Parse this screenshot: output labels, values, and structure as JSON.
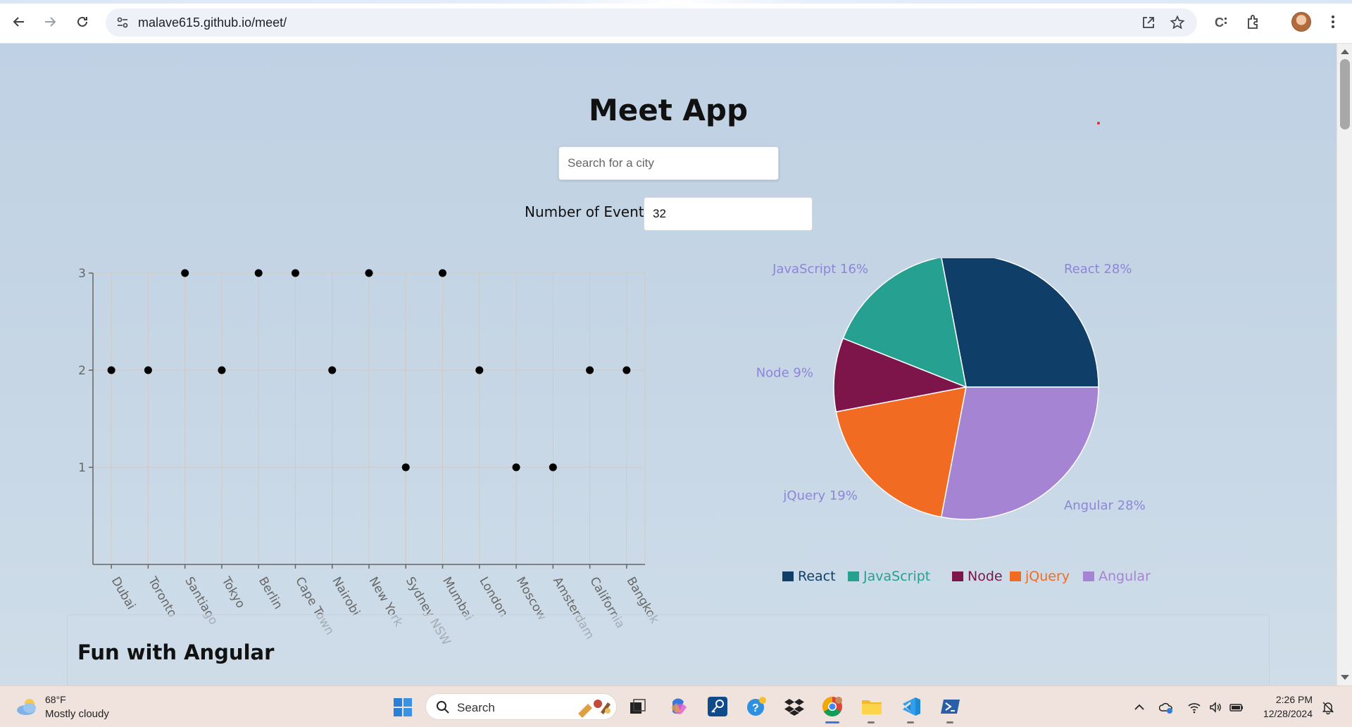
{
  "browser": {
    "url": "malave615.github.io/meet/"
  },
  "app": {
    "title": "Meet App",
    "search_placeholder": "Search for a city",
    "events_label": "Number of Events:",
    "events_value": "32"
  },
  "card": {
    "title": "Fun with Angular"
  },
  "chart_data": [
    {
      "type": "scatter",
      "categories": [
        "Dubai",
        "Toronto",
        "Santiago",
        "Tokyo",
        "Berlin",
        "Cape Town",
        "Nairobi",
        "New York",
        "Sydney NSW",
        "Mumbai",
        "London",
        "Moscow",
        "Amsterdam",
        "California",
        "Bangkok"
      ],
      "values": [
        2,
        2,
        3,
        2,
        3,
        3,
        2,
        3,
        1,
        3,
        2,
        1,
        1,
        2,
        2
      ],
      "yticks": [
        1,
        2,
        3
      ],
      "ylim": [
        0,
        3
      ],
      "grid": true,
      "point_color": "#000000"
    },
    {
      "type": "pie",
      "labels": [
        "React",
        "JavaScript",
        "Node",
        "jQuery",
        "Angular"
      ],
      "values": [
        28,
        16,
        9,
        19,
        28
      ],
      "slice_labels": [
        "React 28%",
        "JavaScript 16%",
        "Node 9%",
        "jQuery 19%",
        "Angular 28%"
      ],
      "colors": [
        "#0f3f68",
        "#26a091",
        "#7d144a",
        "#f26b22",
        "#a584d3"
      ],
      "label_color": "#8d86d8",
      "legend_position": "bottom"
    }
  ],
  "taskbar": {
    "weather_temp": "68°F",
    "weather_desc": "Mostly cloudy",
    "search_label": "Search",
    "clock_time": "2:26 PM",
    "clock_date": "12/28/2024"
  }
}
